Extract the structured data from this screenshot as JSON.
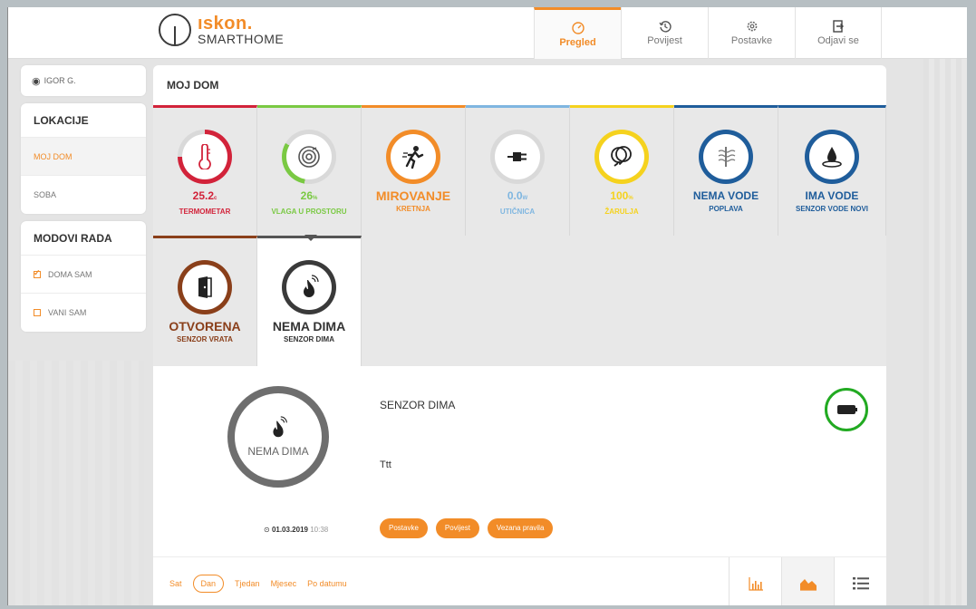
{
  "header": {
    "brand": "ıskon.",
    "brand_sub": "SMARTHOME",
    "nav": [
      {
        "label": "Pregled",
        "icon": "gauge-icon",
        "active": true
      },
      {
        "label": "Povijest",
        "icon": "history-icon",
        "active": false
      },
      {
        "label": "Postavke",
        "icon": "gear-icon",
        "active": false
      },
      {
        "label": "Odjavi se",
        "icon": "logout-icon",
        "active": false
      }
    ]
  },
  "sidebar": {
    "user": "IGOR G.",
    "locations_title": "LOKACIJE",
    "locations": [
      "MOJ DOM",
      "SOBA"
    ],
    "modes_title": "MODOVI RADA",
    "modes": [
      {
        "label": "DOMA SAM",
        "checked": true
      },
      {
        "label": "VANI SAM",
        "checked": false
      }
    ]
  },
  "main": {
    "title": "MOJ DOM",
    "tiles": [
      {
        "value": "25.2",
        "unit": "c",
        "label": "TERMOMETAR",
        "color": "#d2233a",
        "icon": "thermometer-icon"
      },
      {
        "value": "26",
        "unit": "%",
        "label": "VLAGA U PROSTORU",
        "color": "#7ac943",
        "icon": "humidity-icon"
      },
      {
        "value": "MIROVANJE",
        "unit": "",
        "label": "KRETNJA",
        "color": "#f28c28",
        "icon": "motion-icon"
      },
      {
        "value": "0.0",
        "unit": "W",
        "label": "UTIČNICA",
        "color": "#7fb6e0",
        "icon": "plug-icon"
      },
      {
        "value": "100",
        "unit": "%",
        "label": "ŽARULJA",
        "color": "#f5d21e",
        "icon": "bulb-icon"
      },
      {
        "value": "NEMA VODE",
        "unit": "",
        "label": "POPLAVA",
        "color": "#1f5d9b",
        "icon": "flood-icon"
      },
      {
        "value": "IMA VODE",
        "unit": "",
        "label": "SENZOR VODE NOVI",
        "color": "#1f5d9b",
        "icon": "water-drop-icon"
      },
      {
        "value": "OTVORENA",
        "unit": "",
        "label": "SENZOR VRATA",
        "color": "#8a3f1a",
        "icon": "door-icon"
      },
      {
        "value": "NEMA DIMA",
        "unit": "",
        "label": "SENZOR DIMA",
        "color": "#3a3a3a",
        "icon": "smoke-icon"
      }
    ]
  },
  "detail": {
    "ring_text": "NEMA DIMA",
    "title": "SENZOR DIMA",
    "description": "Ttt",
    "date": "01.03.2019",
    "time": "10:38",
    "buttons": [
      "Postavke",
      "Povijest",
      "Vezana pravila"
    ]
  },
  "bottom": {
    "periods": [
      "Sat",
      "Dan",
      "Tjedan",
      "Mjesec",
      "Po datumu"
    ],
    "active_period": "Dan"
  },
  "colors": {
    "accent": "#f28c28",
    "battery": "#22aa22"
  }
}
